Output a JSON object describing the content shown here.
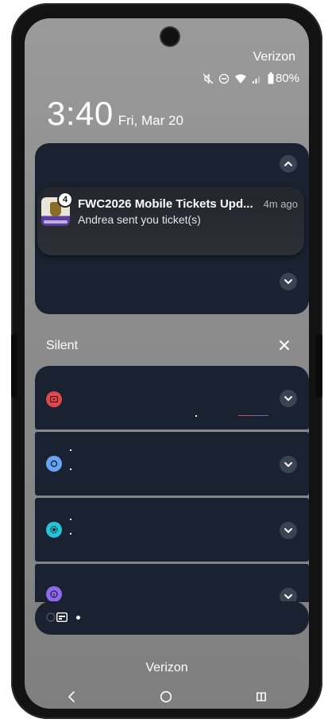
{
  "status_bar": {
    "carrier": "Verizon",
    "battery": "80%"
  },
  "lockscreen": {
    "time": "3:40",
    "date": "Fri, Mar 20"
  },
  "notification": {
    "badge_count": "4",
    "title": "FWC2026 Mobile Tickets Upd...",
    "time_ago": "4m ago",
    "body": "Andrea sent you ticket(s)"
  },
  "silent_section": {
    "label": "Silent"
  },
  "bottom": {
    "carrier": "Verizon"
  },
  "colors": {
    "card_bg": "#1a2130",
    "red_icon": "#e0474c",
    "blue_icon": "#6aa4f0",
    "cyan_icon": "#27c3d6",
    "purple_icon": "#8b6be8"
  },
  "icons": [
    "mute-icon",
    "dnd-icon",
    "wifi-icon",
    "signal-icon",
    "battery-icon",
    "chevron-up-icon",
    "chevron-down-icon",
    "close-icon",
    "back-icon",
    "home-icon",
    "recents-icon"
  ]
}
